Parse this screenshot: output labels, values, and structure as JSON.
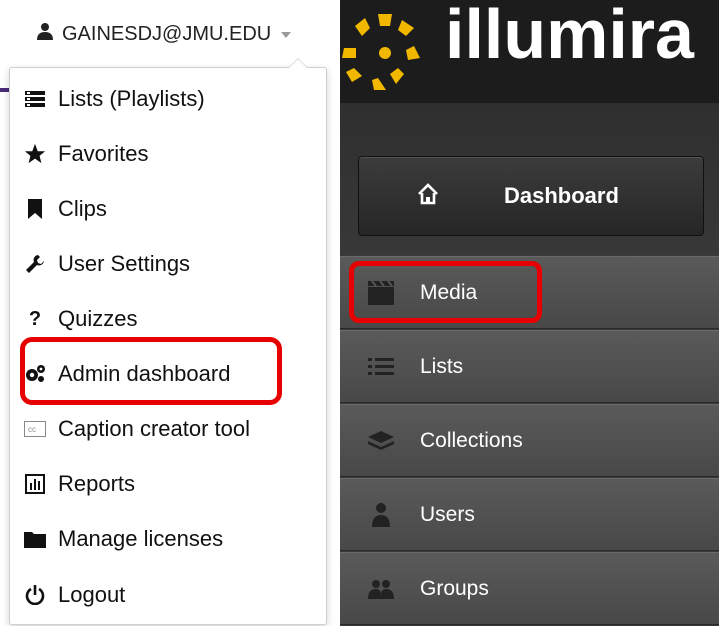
{
  "user": {
    "email": "GAINESDJ@JMU.EDU"
  },
  "menu": {
    "items": [
      {
        "label": "Lists (Playlists)",
        "icon": "list-icon"
      },
      {
        "label": "Favorites",
        "icon": "star-icon"
      },
      {
        "label": "Clips",
        "icon": "bookmark-icon"
      },
      {
        "label": "User Settings",
        "icon": "wrench-icon"
      },
      {
        "label": "Quizzes",
        "icon": "question-icon"
      },
      {
        "label": "Admin dashboard",
        "icon": "gears-icon"
      },
      {
        "label": "Caption creator tool",
        "icon": "cc-icon"
      },
      {
        "label": "Reports",
        "icon": "bar-chart-icon"
      },
      {
        "label": "Manage licenses",
        "icon": "folder-icon"
      },
      {
        "label": "Logout",
        "icon": "power-icon"
      }
    ]
  },
  "brand": {
    "name": "illumira"
  },
  "nav": {
    "dashboard": "Dashboard",
    "items": [
      {
        "label": "Media",
        "icon": "film-icon"
      },
      {
        "label": "Lists",
        "icon": "list-icon"
      },
      {
        "label": "Collections",
        "icon": "stack-icon"
      },
      {
        "label": "Users",
        "icon": "user-icon"
      },
      {
        "label": "Groups",
        "icon": "group-icon"
      }
    ]
  },
  "colors": {
    "highlight": "#e60000",
    "panel": "#3a3a3a",
    "brand_bg": "#1c1c1c"
  }
}
